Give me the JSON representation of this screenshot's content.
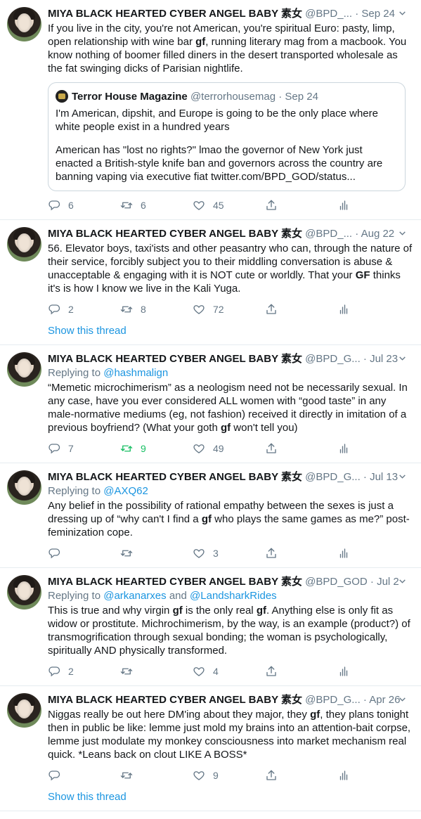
{
  "tweets": [
    {
      "name": "MIYA BLACK HEARTED CYBER ANGEL BABY 素女",
      "handle": "@BPD_...",
      "date": "Sep 24",
      "reply_prefix": "",
      "reply_mentions": [],
      "segments": [
        "If you live in the city, you're not American, you're spiritual Euro: pasty, limp, open relationship with wine bar ",
        {
          "bold": "gf"
        },
        ", running literary mag from a macbook. You know nothing of boomer filled diners in the desert transported wholesale as the fat swinging dicks of Parisian nightlife."
      ],
      "quote": {
        "name": "Terror House Magazine",
        "handle": "@terrorhousemag",
        "date": "Sep 24",
        "paragraphs": [
          "I'm American, dipshit, and Europe is going to be the only place where white people exist in a hundred years",
          "American has \"lost no rights?\" lmao the governor of New York just enacted a British-style knife ban and governors across the country are banning vaping via executive fiat twitter.com/BPD_GOD/status..."
        ]
      },
      "replies": "6",
      "retweets": "6",
      "likes": "45",
      "retweeted": false,
      "show_thread": ""
    },
    {
      "name": "MIYA BLACK HEARTED CYBER ANGEL BABY 素女",
      "handle": "@BPD_...",
      "date": "Aug 22",
      "reply_prefix": "",
      "reply_mentions": [],
      "segments": [
        "56. Elevator boys, taxi'ists and other peasantry who can, through the nature of their service, forcibly subject you to their middling conversation is abuse & unacceptable & engaging with it is NOT cute or worldly. That your ",
        {
          "bold": "GF"
        },
        " thinks it's is how I know we live in the Kali Yuga."
      ],
      "quote": null,
      "replies": "2",
      "retweets": "8",
      "likes": "72",
      "retweeted": false,
      "show_thread": "Show this thread"
    },
    {
      "name": "MIYA BLACK HEARTED CYBER ANGEL BABY 素女",
      "handle": "@BPD_G...",
      "date": "Jul 23",
      "reply_prefix": "Replying to",
      "reply_mentions": [
        "@hashmalign"
      ],
      "segments": [
        "“Memetic microchimerism” as a neologism need not be necessarily sexual. In any case, have you ever considered ALL women with “good taste” in any male-normative mediums (eg, not fashion) received it directly in imitation of a previous boyfriend? (What your goth ",
        {
          "bold": "gf"
        },
        " won't tell you)"
      ],
      "quote": null,
      "replies": "7",
      "retweets": "9",
      "likes": "49",
      "retweeted": true,
      "show_thread": ""
    },
    {
      "name": "MIYA BLACK HEARTED CYBER ANGEL BABY 素女",
      "handle": "@BPD_G...",
      "date": "Jul 13",
      "reply_prefix": "Replying to",
      "reply_mentions": [
        "@AXQ62"
      ],
      "segments": [
        "Any belief in the possibility of rational empathy between the sexes is just a dressing up of “why can't I find a ",
        {
          "bold": "gf"
        },
        " who plays the same games as me?” post-feminization cope."
      ],
      "quote": null,
      "replies": "",
      "retweets": "",
      "likes": "3",
      "retweeted": false,
      "show_thread": ""
    },
    {
      "name": "MIYA BLACK HEARTED CYBER ANGEL BABY 素女",
      "handle": "@BPD_GOD",
      "date": "Jul 2",
      "reply_prefix": "Replying to",
      "reply_mentions": [
        "@arkanarxes",
        "and",
        "@LandsharkRides"
      ],
      "segments": [
        "This is true and why virgin ",
        {
          "bold": "gf"
        },
        " is the only real ",
        {
          "bold": "gf"
        },
        ". Anything else is only fit as widow or prostitute. Michrochimerism, by the way, is an example (product?) of transmogrification through sexual bonding; the woman is psychologically, spiritually AND physically transformed."
      ],
      "quote": null,
      "replies": "2",
      "retweets": "",
      "likes": "4",
      "retweeted": false,
      "show_thread": ""
    },
    {
      "name": "MIYA BLACK HEARTED CYBER ANGEL BABY 素女",
      "handle": "@BPD_G...",
      "date": "Apr 26",
      "reply_prefix": "",
      "reply_mentions": [],
      "segments": [
        "Niggas really be out here DM'ing about they major, they ",
        {
          "bold": "gf"
        },
        ", they plans tonight then in public be like: lemme just mold my brains into an attention-bait corpse, lemme just modulate my monkey consciousness into market mechanism real quick. *Leans back on clout LIKE A BOSS*"
      ],
      "quote": null,
      "replies": "",
      "retweets": "",
      "likes": "9",
      "retweeted": false,
      "show_thread": "Show this thread"
    }
  ],
  "ui": {
    "separator": "·",
    "caret_icon": "chevron-down-icon",
    "colors": {
      "link": "#1b95e0",
      "muted": "#657786",
      "retweet_active": "#17bf63"
    }
  }
}
